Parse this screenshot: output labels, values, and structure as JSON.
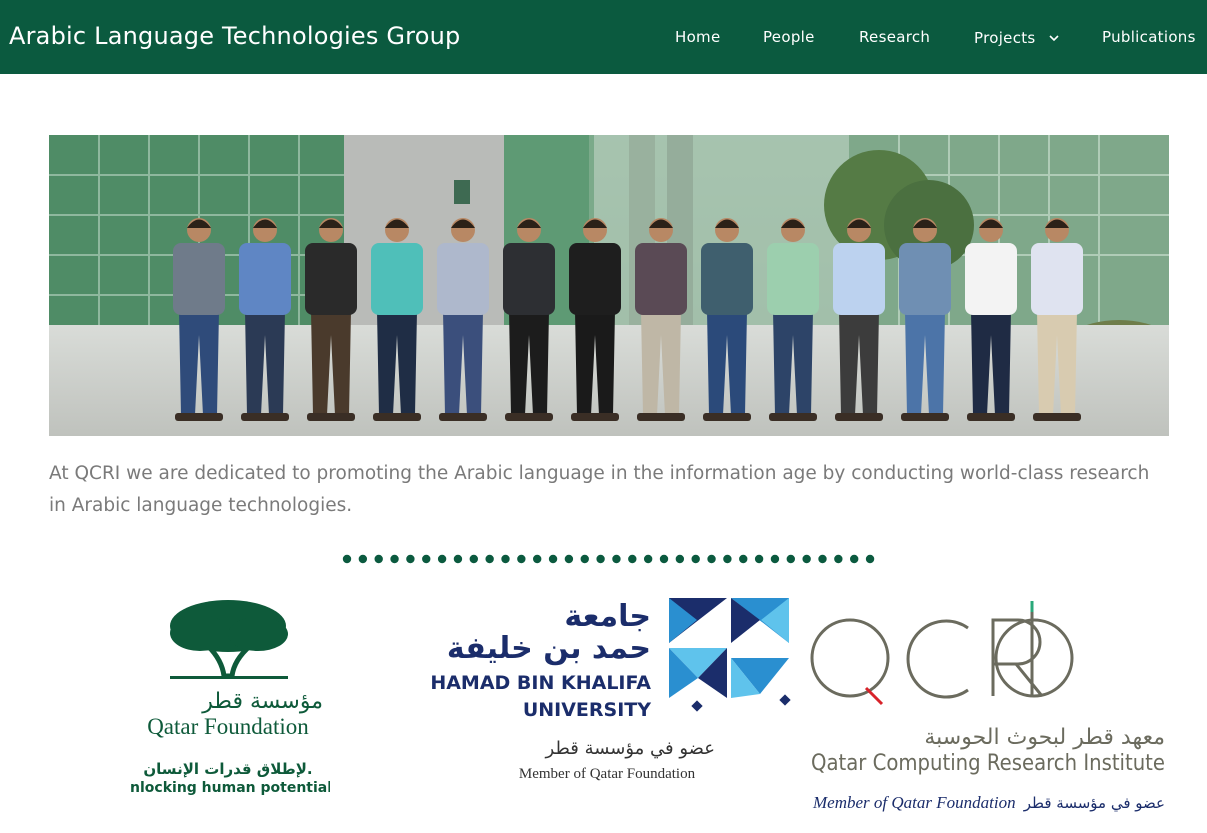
{
  "site": {
    "title": "Arabic Language Technologies Group"
  },
  "nav": {
    "items": [
      {
        "label": "Home"
      },
      {
        "label": "People"
      },
      {
        "label": "Research"
      },
      {
        "label": "Projects"
      },
      {
        "label": "Publications"
      }
    ]
  },
  "colors": {
    "header_bg": "#0b5a3f",
    "dot_green": "#0b5a3f",
    "intro_text": "#7a7a7a"
  },
  "hero": {
    "alt": "Group photo of team members standing in front of a glass building"
  },
  "intro": {
    "text": "At QCRI we are dedicated to promoting the Arabic language in the information age by conducting world-class research in Arabic language technologies."
  },
  "logos": {
    "qf": {
      "arabic_name": "مؤسسة قطر",
      "english_name": "Qatar Foundation",
      "arabic_tagline": "لإطلاق قدرات الإنسان.",
      "tagline": "Unlocking human potential."
    },
    "hbku": {
      "arabic_name_line1": "جامعة",
      "arabic_name_line2": "حمد بن خليفة",
      "name_line1": "HAMAD BIN KHALIFA",
      "name_line2": "UNIVERSITY",
      "arabic_member": "عضو في مؤسسة قطر",
      "member": "Member of Qatar Foundation"
    },
    "qcri": {
      "wordmark": "QCRI",
      "arabic_name": "معهد قطر لبحوث الحوسبة",
      "english_name": "Qatar Computing Research Institute",
      "member": "Member of Qatar Foundation",
      "arabic_member": "عضو في مؤسسة قطر"
    }
  }
}
